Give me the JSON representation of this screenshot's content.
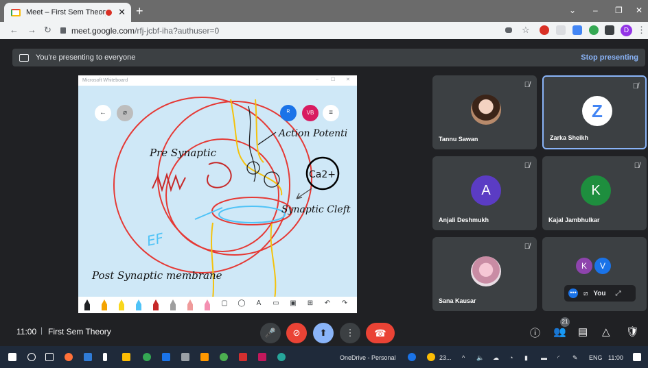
{
  "browser": {
    "tab_title": "Meet – First Sem Theory",
    "tab_close": "✕",
    "new_tab": "+",
    "window_controls": [
      "⌄",
      "–",
      "❐",
      "✕"
    ],
    "nav": {
      "back": "←",
      "forward": "→",
      "reload": "↻"
    },
    "url_host": "meet.google.com",
    "url_path": "/rfj-jcbf-iha?authuser=0",
    "star": "☆",
    "profile_initial": "D",
    "menu": "⋮"
  },
  "presenting": {
    "message": "You're presenting to everyone",
    "stop_label": "Stop presenting"
  },
  "whiteboard": {
    "window_title": "Microsoft Whiteboard",
    "window_controls": [
      "–",
      "☐",
      "✕"
    ],
    "back_icon": "←",
    "menu_icon": "≡",
    "collab_badge": "VB",
    "labels": {
      "pre_synaptic": "Pre Synaptic",
      "action_potential": "Action Potenti",
      "calcium": "Ca2+",
      "synaptic_cleft": "Synaptic Cleft",
      "ef": "EF",
      "post_synaptic": "Post Synaptic membrane"
    },
    "tool_letter": "A"
  },
  "participants": [
    {
      "name": "Tannu Sawan",
      "avatar": "",
      "avatar_color": "#3c4043",
      "photo": true
    },
    {
      "name": "Zarka Sheikh",
      "avatar": "Z",
      "avatar_color": "#ffffff",
      "active": true
    },
    {
      "name": "Anjali Deshmukh",
      "avatar": "A",
      "avatar_color": "#5b3cc4"
    },
    {
      "name": "Kajal Jambhulkar",
      "avatar": "K",
      "avatar_color": "#1e8e3e"
    },
    {
      "name": "Sana Kausar",
      "avatar": "",
      "avatar_color": "#3c4043",
      "photo": true
    }
  ],
  "self_tile": {
    "avatars": [
      "K",
      "V"
    ],
    "avatar_colors": [
      "#8e44ad",
      "#1a73e8"
    ],
    "label": "You"
  },
  "meeting": {
    "time": "11:00",
    "separator": "|",
    "title": "First Sem Theory",
    "people_count": "21"
  },
  "taskbar": {
    "onedrive_label": "OneDrive - Personal",
    "weather": "23...",
    "language": "ENG",
    "clock": "11:00"
  }
}
